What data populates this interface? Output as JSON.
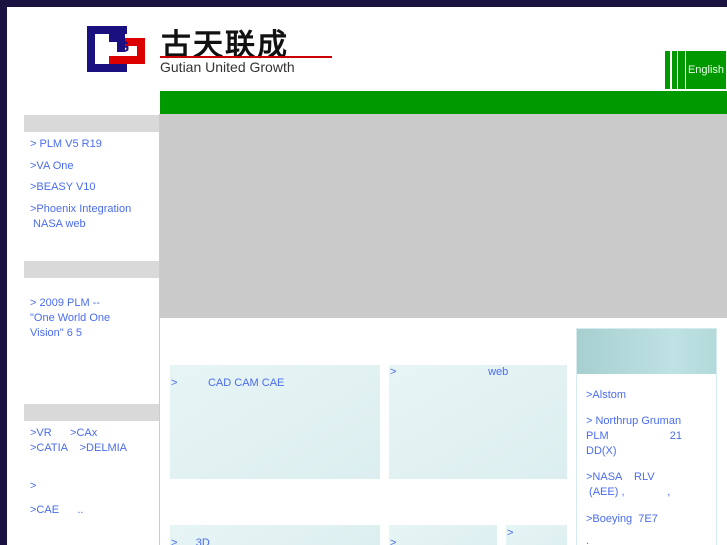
{
  "header": {
    "logo_cn": "古天联成",
    "logo_en": "Gutian United Growth",
    "language_button": "English"
  },
  "sidebar": {
    "section1": [
      "> PLM V5 R19",
      ">VA One",
      ">BEASY V10",
      ">Phoenix Integration\n NASA web"
    ],
    "section2": [
      "> 2009 PLM --\n\"One World One\nVision\" 6 5"
    ],
    "section3": [
      ">VR      >CAx\n>CATIA    >DELMIA",
      "> ",
      ">CAE      .."
    ]
  },
  "cards": {
    "c1": ">          CAD CAM CAE",
    "c2": ">                              web",
    "c3": ">      3D",
    "c4": ">",
    "c5": ">"
  },
  "right_panel": {
    "items": [
      ">Alstom",
      "> Northrup Gruman\nPLM                    21\nDD(X)",
      ">NASA    RLV\n (AEE) ,              ,",
      ">Boeying  7E7",
      "."
    ]
  },
  "colors": {
    "green": "#009900",
    "link": "#4a6cf0",
    "border": "#1a1240"
  }
}
